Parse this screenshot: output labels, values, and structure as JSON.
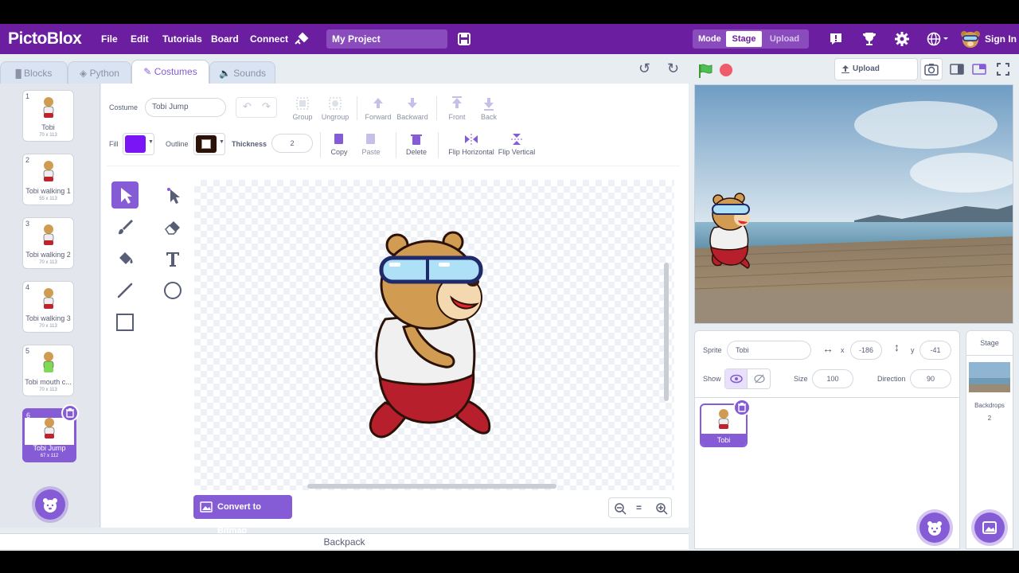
{
  "app": {
    "logo": "PictoBlox",
    "menu": [
      "File",
      "Edit",
      "Tutorials",
      "Board",
      "Connect"
    ],
    "project_name": "My Project",
    "mode_label": "Mode",
    "mode_stage": "Stage",
    "mode_upload": "Upload",
    "sign_in": "Sign In"
  },
  "tabs": {
    "blocks": "Blocks",
    "python": "Python",
    "costumes": "Costumes",
    "sounds": "Sounds"
  },
  "costumes": [
    {
      "num": "1",
      "name": "Tobi",
      "size": "70 x 113"
    },
    {
      "num": "2",
      "name": "Tobi walking 1",
      "size": "55 x 113"
    },
    {
      "num": "3",
      "name": "Tobi walking 2",
      "size": "70 x 113"
    },
    {
      "num": "4",
      "name": "Tobi walking 3",
      "size": "70 x 113"
    },
    {
      "num": "5",
      "name": "Tobi mouth c...",
      "size": "70 x 113"
    },
    {
      "num": "6",
      "name": "Tobi Jump",
      "size": "67 x 112"
    }
  ],
  "editor": {
    "costume_label": "Costume",
    "costume_name": "Tobi Jump",
    "group": "Group",
    "ungroup": "Ungroup",
    "forward": "Forward",
    "backward": "Backward",
    "front": "Front",
    "back": "Back",
    "fill_label": "Fill",
    "outline_label": "Outline",
    "thickness_label": "Thickness",
    "thickness_value": "2",
    "copy": "Copy",
    "paste": "Paste",
    "delete": "Delete",
    "flip_h": "Flip Horizontal",
    "flip_v": "Flip Vertical",
    "convert": "Convert to Bitmap",
    "zoom_reset": "="
  },
  "colors": {
    "accent": "#855cd6",
    "topbar": "#6b1fa0",
    "fill": "#7a16f5",
    "outline": "#2b1208"
  },
  "backpack": "Backpack",
  "stage_header": {
    "upload_firmware": "Upload Firmware"
  },
  "sprite_info": {
    "sprite_label": "Sprite",
    "sprite_name": "Tobi",
    "x_label": "x",
    "x_value": "-186",
    "y_label": "y",
    "y_value": "-41",
    "show_label": "Show",
    "size_label": "Size",
    "size_value": "100",
    "direction_label": "Direction",
    "direction_value": "90",
    "sprite_tile": "Tobi"
  },
  "stage_panel": {
    "title": "Stage",
    "backdrops_label": "Backdrops",
    "backdrops_count": "2"
  }
}
